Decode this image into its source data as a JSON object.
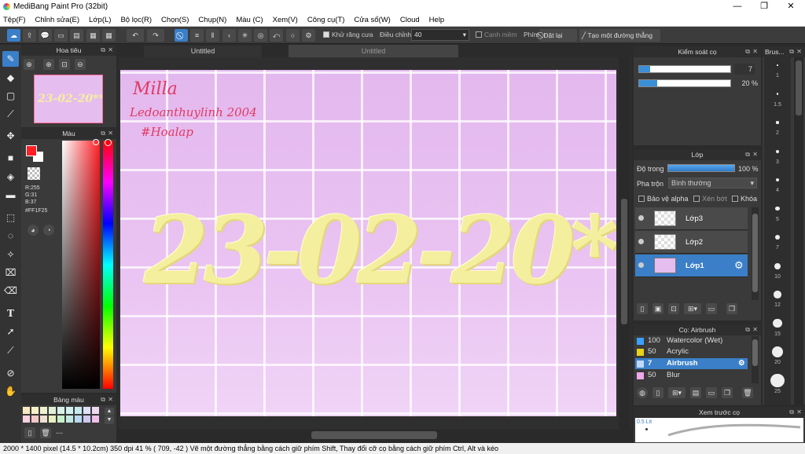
{
  "window": {
    "title": "MediBang Paint Pro (32bit)",
    "minimize": "—",
    "maximize": "❐",
    "close": "✕"
  },
  "menu": [
    "Tệp(F)",
    "Chỉnh sửa(E)",
    "Lớp(L)",
    "Bộ lọc(R)",
    "Chọn(S)",
    "Chụp(N)",
    "Màu (C)",
    "Xem(V)",
    "Công cụ(T)",
    "Cửa sổ(W)",
    "Cloud",
    "Help"
  ],
  "toolbar": {
    "antialias_label": "Khử răng cưa",
    "adjust_label": "Điều chỉnh",
    "adjust_value": "40",
    "edge_label": "Cạnh mềm",
    "hotkey_label": "Phím",
    "reset_label": "Đặt lại",
    "line_label": "Tạo một đường thẳng"
  },
  "tabs": [
    "Untitled",
    "Untitled"
  ],
  "panels": {
    "navigator": "Hoa tiêu",
    "color": "Màu",
    "palette": "Bảng màu",
    "brush_control": "Kiểm soát cọ",
    "layer": "Lớp",
    "brush_panel": "Cọ: Airbrush",
    "preview": "Xem trước cọ",
    "brush_size": "Brus..."
  },
  "navigator_preview_text": "23-02-20**",
  "color": {
    "r": "R:255",
    "g": "G:31",
    "b": "B:37",
    "hex": "#FF1F25",
    "primary": "#ff1f25",
    "secondary": "#ffffff"
  },
  "brush_control": {
    "size_value": "7",
    "opacity_value": "20 %",
    "size_fraction": 0.12,
    "opacity_fraction": 0.2
  },
  "layer_panel": {
    "opacity_label": "Độ trong",
    "opacity_value": "100 %",
    "blend_label": "Pha trộn",
    "blend_value": "Bình thường",
    "protect_alpha": "Bảo vệ alpha",
    "clipping": "Xén bớt",
    "lock": "Khóa",
    "layers": [
      {
        "name": "Lớp3",
        "selected": false
      },
      {
        "name": "Lớp2",
        "selected": false
      },
      {
        "name": "Lớp1",
        "selected": true
      }
    ]
  },
  "brushes": [
    {
      "size": "100",
      "name": "Watercolor (Wet)",
      "color": "#3ca0ff"
    },
    {
      "size": "50",
      "name": "Acrylic",
      "color": "#e8d21a"
    },
    {
      "size": "7",
      "name": "Airbrush",
      "color": "#c0d8f8"
    },
    {
      "size": "50",
      "name": "Blur",
      "color": "#f0a8e8"
    }
  ],
  "brush_sizes": [
    "1",
    "1.5",
    "2",
    "3",
    "4",
    "5",
    "7",
    "10",
    "12",
    "15",
    "20",
    "25"
  ],
  "preview_size": "0.5 Lit",
  "canvas": {
    "name_line": "Milla",
    "handwriting": "Ledoanthuylinh 2004",
    "hashtag": "#Hoalap",
    "big_text": "23-02-20**"
  },
  "status": "2000 * 1400 pixel  (14.5 * 10.2cm)  350 dpi  41 %  ( 709, -42 )  Vẽ một đường thẳng bằng cách giữ phím Shift, Thay đổi cỡ cọ bằng cách giữ phím Ctrl, Alt và kéo",
  "palette_colors": [
    "#f8e8c0",
    "#f8f0c8",
    "#f0f0d0",
    "#e0f0d8",
    "#d8f0e8",
    "#d0f0f0",
    "#c8e8f0",
    "#e0e0f8",
    "#f0d8f0",
    "#f8d0e0",
    "#f8c8c8",
    "#f0e0d0",
    "#e8f0c0",
    "#c8f0c8",
    "#c0e8e0",
    "#b8d8f0",
    "#d0c8f0",
    "#f0c0e8"
  ]
}
